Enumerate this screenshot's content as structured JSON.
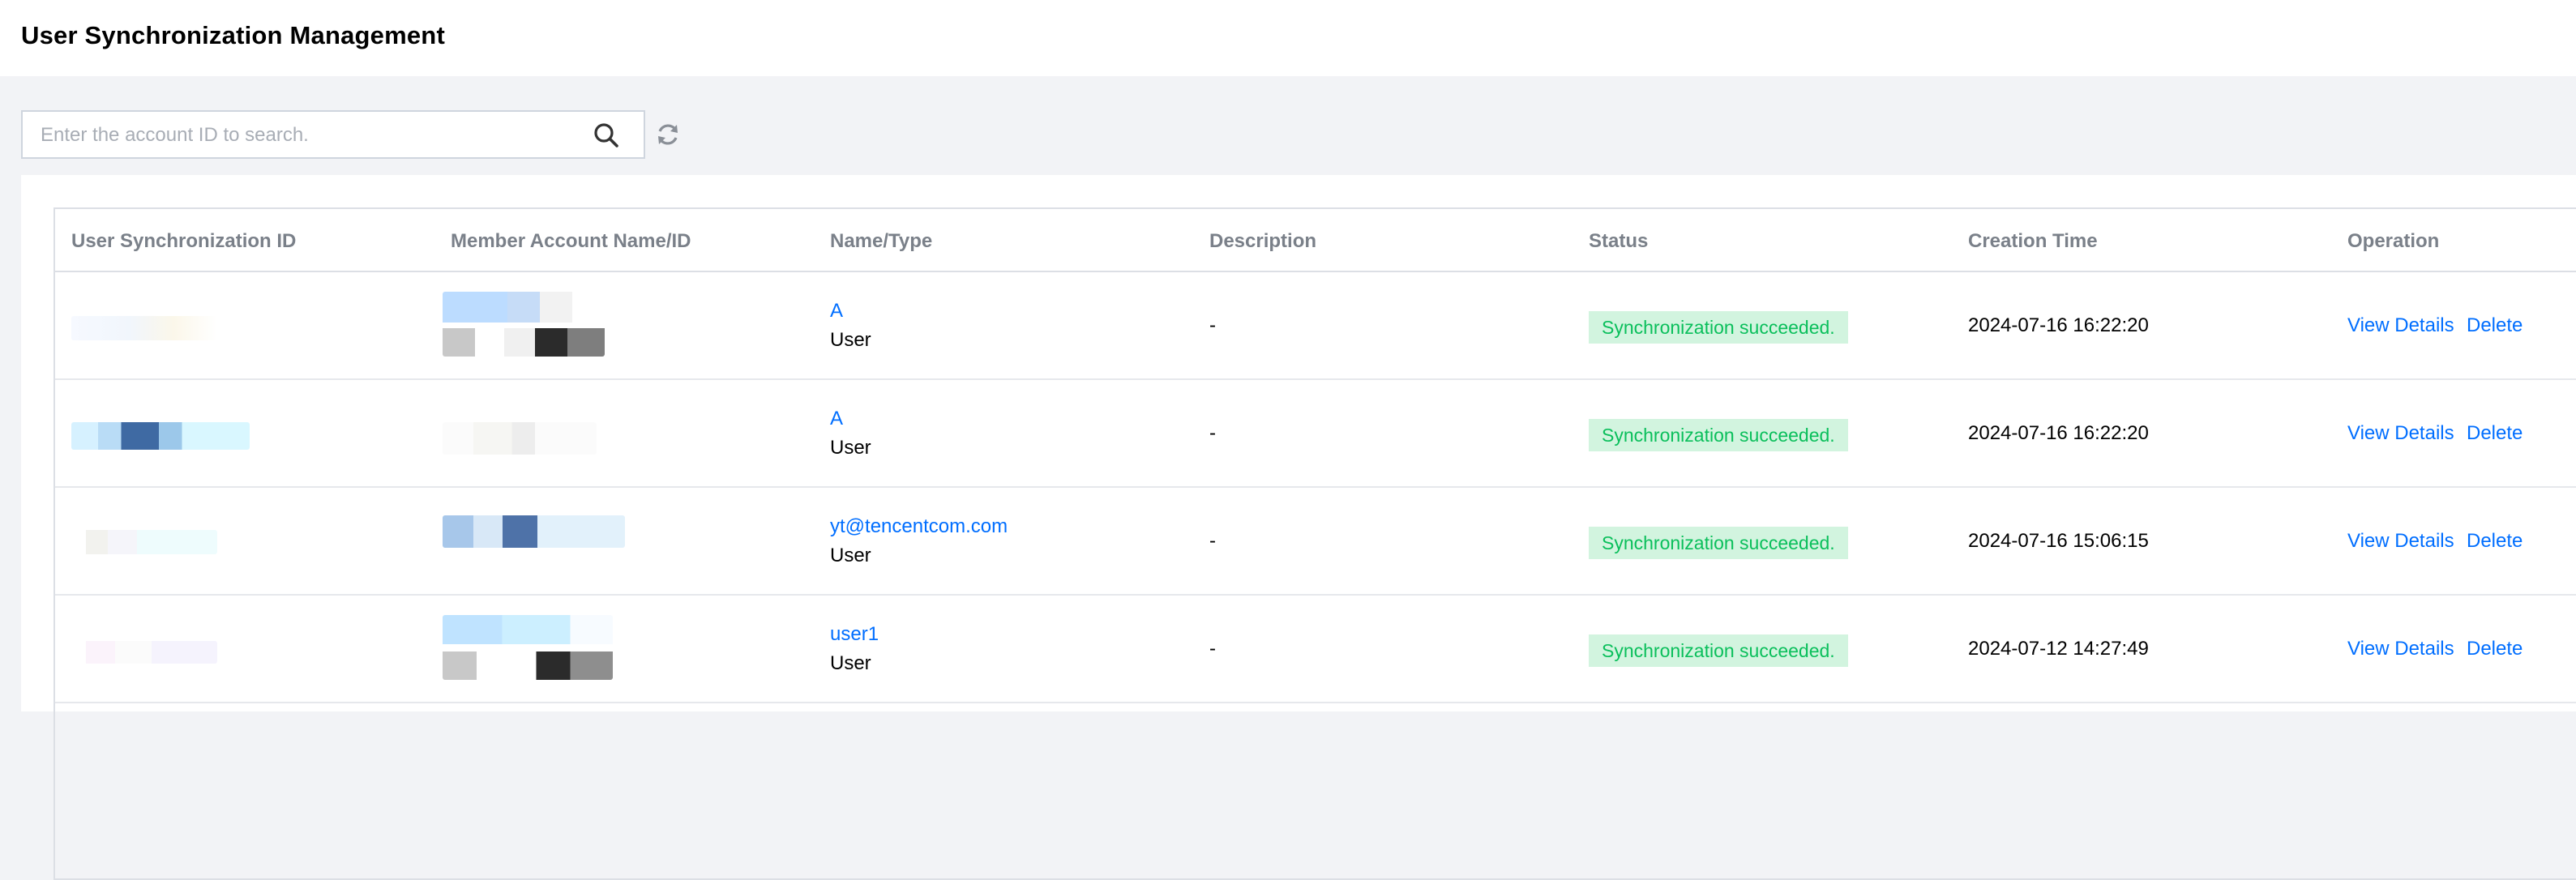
{
  "page": {
    "title": "User Synchronization Management"
  },
  "search": {
    "placeholder": "Enter the account ID to search."
  },
  "icons": {
    "search": "search-icon",
    "refresh": "refresh-icon"
  },
  "colors": {
    "link": "#006eff",
    "success_text": "#0abf5b",
    "success_bg": "#d2f4df"
  },
  "table": {
    "columns": [
      "User Synchronization ID",
      "Member Account Name/ID",
      "Name/Type",
      "Description",
      "Status",
      "Creation Time",
      "Operation"
    ],
    "rows": [
      {
        "name": "A",
        "type": "User",
        "description": "-",
        "status": "Synchronization succeeded.",
        "created": "2024-07-16 16:22:20",
        "actions": [
          "View Details",
          "Delete"
        ]
      },
      {
        "name": "A",
        "type": "User",
        "description": "-",
        "status": "Synchronization succeeded.",
        "created": "2024-07-16 16:22:20",
        "actions": [
          "View Details",
          "Delete"
        ]
      },
      {
        "name": "yt@tencentcom.com",
        "type": "User",
        "description": "-",
        "status": "Synchronization succeeded.",
        "created": "2024-07-16 15:06:15",
        "actions": [
          "View Details",
          "Delete"
        ]
      },
      {
        "name": "user1",
        "type": "User",
        "description": "-",
        "status": "Synchronization succeeded.",
        "created": "2024-07-12 14:27:49",
        "actions": [
          "View Details",
          "Delete"
        ]
      }
    ]
  }
}
